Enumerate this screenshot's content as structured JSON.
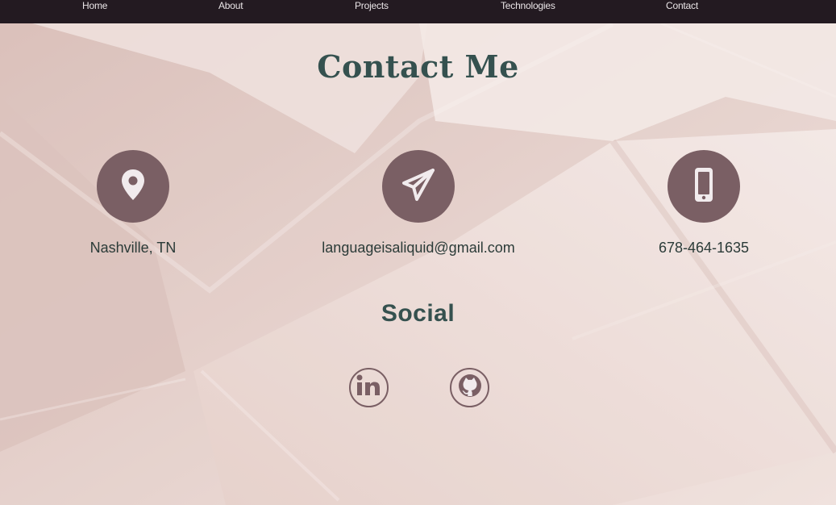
{
  "nav": {
    "items": [
      "Home",
      "About",
      "Projects",
      "Technologies",
      "Contact"
    ]
  },
  "header": {
    "title": "Contact Me"
  },
  "contact": {
    "location": "Nashville, TN",
    "email": "languageisaliquid@gmail.com",
    "phone": "678-464-1635"
  },
  "social": {
    "title": "Social",
    "links": [
      {
        "icon": "linkedin-icon"
      },
      {
        "icon": "github-icon"
      }
    ]
  },
  "icons": {
    "location": "map-pin-icon",
    "email": "paper-plane-icon",
    "phone": "mobile-phone-icon"
  },
  "colors": {
    "nav_bg": "#231a21",
    "accent": "#7a5f64",
    "heading": "#35514f",
    "background": "#e9d6d1"
  }
}
